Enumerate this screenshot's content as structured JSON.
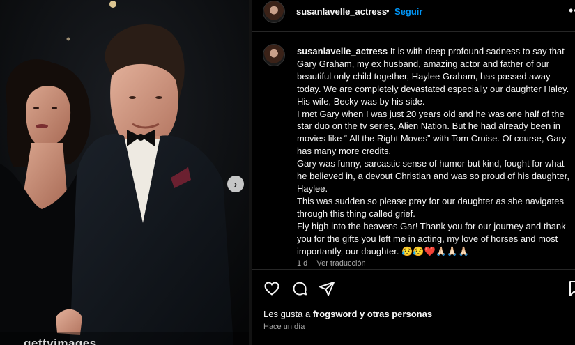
{
  "post": {
    "watermark": "gettyimages",
    "next_label": "›"
  },
  "header": {
    "username": "susanlavelle_actress",
    "separator": "•",
    "follow_label": "Seguir",
    "more_label": "•••"
  },
  "caption": {
    "username": "susanlavelle_actress",
    "paragraphs": [
      "It is with deep profound sadness to say that Gary Graham, my ex husband, amazing actor and father of our beautiful only child together, Haylee Graham, has passed away today. We are completely devastated especially our daughter Haley. His wife, Becky was by his side.",
      "I met Gary when I was just 20 years old and he was one half of the star duo on the tv series, Alien Nation. But he had already been in movies like “ All the Right Moves” with Tom Cruise. Of course, Gary has many more credits.",
      "Gary was funny, sarcastic sense of humor but kind, fought for what he believed in, a devout Christian and was so proud of his daughter, Haylee.",
      "This was sudden so please pray for our daughter as she navigates through this thing called grief.",
      "Fly high into the heavens Gar! Thank you for our journey and thank you for the gifts you left me in acting, my love of horses and most importantly, our daughter. 😥😥❤️🙏🏻🙏🏻🙏🏻"
    ],
    "age": "1 d",
    "translate_label": "Ver traducción"
  },
  "actions": {
    "icons": [
      "heart-icon",
      "comment-icon",
      "share-icon",
      "bookmark-icon"
    ],
    "likes_prefix": "Les gusta a ",
    "likes_user": "frogsword",
    "likes_suffix": " y otras personas",
    "timestamp": "Hace un día"
  }
}
